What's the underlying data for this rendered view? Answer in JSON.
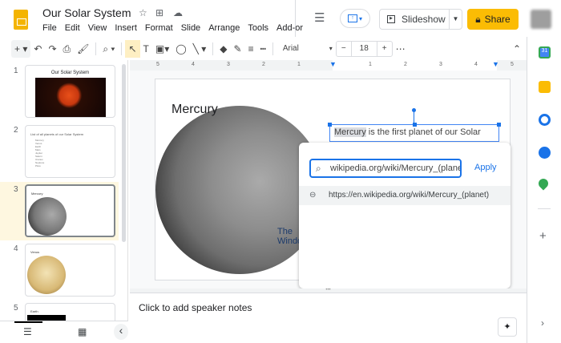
{
  "header": {
    "title": "Our Solar System",
    "menu": [
      "File",
      "Edit",
      "View",
      "Insert",
      "Format",
      "Slide",
      "Arrange",
      "Tools",
      "Add-or"
    ],
    "slideshow_label": "Slideshow",
    "share_label": "Share"
  },
  "toolbar": {
    "font": "Arial",
    "font_size": "18"
  },
  "ruler": {
    "left": [
      "5",
      "4",
      "3",
      "2",
      "1"
    ],
    "right": [
      "1",
      "2",
      "3",
      "4",
      "5"
    ]
  },
  "filmstrip": {
    "slides": [
      {
        "num": "1",
        "title": "Our Solar System"
      },
      {
        "num": "2",
        "title": "List of all planets of our Solar System",
        "items": [
          "Mercury",
          "Venus",
          "Earth",
          "Mars",
          "Jupiter",
          "Saturn",
          "Uranus",
          "Neptune",
          "Pluto"
        ]
      },
      {
        "num": "3",
        "title": "Mercury"
      },
      {
        "num": "4",
        "title": "Venus"
      },
      {
        "num": "5",
        "title": "Earth"
      }
    ]
  },
  "slide": {
    "title": "Mercury",
    "text_highlight": "Mercury",
    "text_rest": " is the first planet of our Solar"
  },
  "link_popup": {
    "input_value": "wikipedia.org/wiki/Mercury_(planet)",
    "apply_label": "Apply",
    "suggestion": "https://en.wikipedia.org/wiki/Mercury_(planet)"
  },
  "notes": {
    "placeholder": "Click to add speaker notes"
  },
  "watermark": {
    "line1": "The",
    "line2": "WindowsClub"
  }
}
